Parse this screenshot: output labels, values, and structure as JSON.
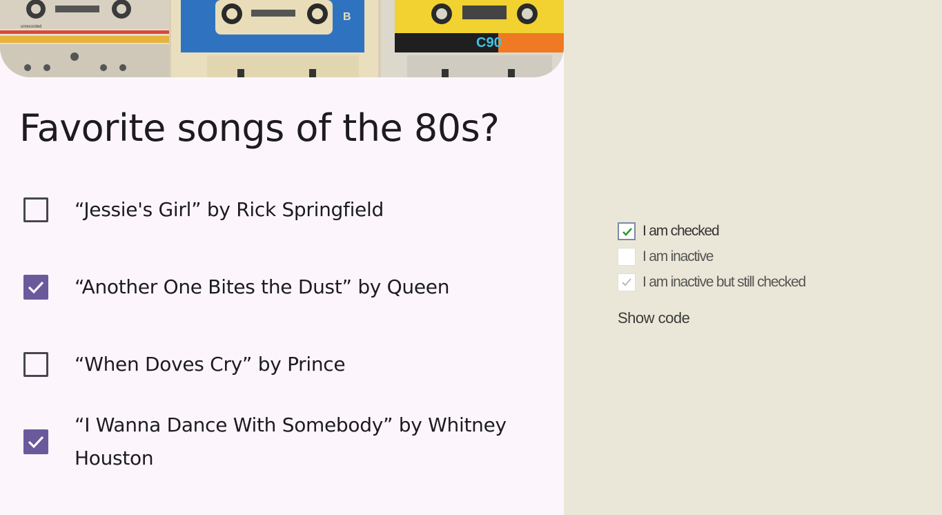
{
  "form": {
    "title": "Favorite songs of the 80s?",
    "options": [
      {
        "label": "“Jessie's Girl” by Rick Springfield",
        "checked": false
      },
      {
        "label": "“Another One Bites the Dust” by Queen",
        "checked": true
      },
      {
        "label": "“When Doves Cry” by Prince",
        "checked": false
      },
      {
        "label": "“I Wanna Dance With Somebody” by Whitney Houston",
        "checked": true
      }
    ],
    "accent_color": "#6a5a9c"
  },
  "hero": {
    "cassette_labels": [
      "unrecorded",
      "B",
      "C90"
    ]
  },
  "classic": {
    "items": [
      {
        "label": "I am checked",
        "checked": true,
        "active": true
      },
      {
        "label": "I am inactive",
        "checked": false,
        "active": false
      },
      {
        "label": "I am inactive but still checked",
        "checked": true,
        "active": false
      }
    ],
    "show_code_label": "Show code",
    "check_color_active": "#2a9d2a",
    "check_color_inactive": "#b8b8b8"
  }
}
